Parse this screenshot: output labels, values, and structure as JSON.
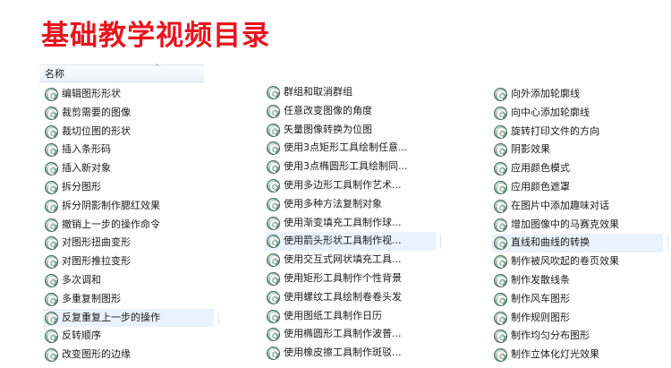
{
  "title": "基础教学视频目录",
  "header": {
    "column_name": "名称"
  },
  "columns": [
    {
      "selected": 12,
      "items": [
        "编辑图形形状",
        "裁剪需要的图像",
        "裁切位图的形状",
        "插入条形码",
        "插入新对象",
        "拆分图形",
        "拆分阴影制作腮红效果",
        "撤销上一步的操作命令",
        "对图形扭曲变形",
        "对图形推拉变形",
        "多次调和",
        "多重复制图形",
        "反复重复上一步的操作",
        "反转顺序",
        "改变图形的边缘"
      ]
    },
    {
      "selected": 8,
      "items": [
        "群组和取消群组",
        "任意改变图像的角度",
        "矢量图像转换为位图",
        "使用3点矩形工具绘制任意...",
        "使用3点椭圆形工具绘制同...",
        "使用多边形工具制作艺术...",
        "使用多种方法复制对象",
        "使用渐变填充工具制作球...",
        "使用箭头形状工具制作视...",
        "使用交互式网状填充工具...",
        "使用矩形工具制作个性背景",
        "使用螺纹工具绘制卷卷头发",
        "使用图纸工具制作日历",
        "使用椭圆形工具制作波普...",
        "使用橡皮擦工具制作斑驳..."
      ]
    },
    {
      "selected": 8,
      "items": [
        "向外添加轮廓线",
        "向中心添加轮廓线",
        "旋转打印文件的方向",
        "阴影效果",
        "应用颜色模式",
        "应用颜色遮罩",
        "在图片中添加趣味对话",
        "增加图像中的马赛克效果",
        "直线和曲线的转换",
        "制作被风吹起的卷页效果",
        "制作发散线条",
        "制作风车图形",
        "制作规则图形",
        "制作均匀分布图形",
        "制作立体化灯光效果"
      ]
    }
  ]
}
